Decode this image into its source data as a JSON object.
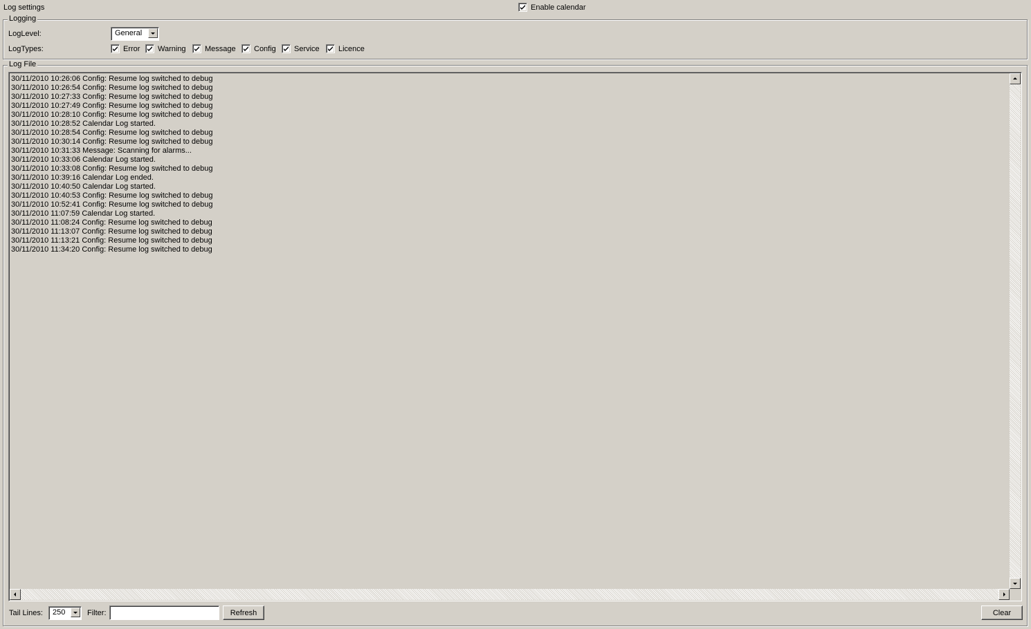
{
  "header": {
    "title": "Log settings",
    "enable_calendar": {
      "label": "Enable calendar",
      "checked": true
    }
  },
  "logging": {
    "legend": "Logging",
    "loglevel_label": "LogLevel:",
    "loglevel_value": "General",
    "logtypes_label": "LogTypes:",
    "logtypes": [
      {
        "label": "Error",
        "checked": true
      },
      {
        "label": "Warning",
        "checked": true
      },
      {
        "label": "Message",
        "checked": true
      },
      {
        "label": "Config",
        "checked": true
      },
      {
        "label": "Service",
        "checked": true
      },
      {
        "label": "Licence",
        "checked": true
      }
    ]
  },
  "logfile": {
    "legend": "Log File",
    "lines": [
      "30/11/2010 10:26:06 Config: Resume log switched to debug",
      "30/11/2010 10:26:54 Config: Resume log switched to debug",
      "30/11/2010 10:27:33 Config: Resume log switched to debug",
      "30/11/2010 10:27:49 Config: Resume log switched to debug",
      "30/11/2010 10:28:10 Config: Resume log switched to debug",
      "30/11/2010 10:28:52 Calendar Log started.",
      "30/11/2010 10:28:54 Config: Resume log switched to debug",
      "30/11/2010 10:30:14 Config: Resume log switched to debug",
      "30/11/2010 10:31:33 Message: Scanning for alarms...",
      "30/11/2010 10:33:06 Calendar Log started.",
      "30/11/2010 10:33:08 Config: Resume log switched to debug",
      "30/11/2010 10:39:16 Calendar Log ended.",
      "30/11/2010 10:40:50 Calendar Log started.",
      "30/11/2010 10:40:53 Config: Resume log switched to debug",
      "30/11/2010 10:52:41 Config: Resume log switched to debug",
      "30/11/2010 11:07:59 Calendar Log started.",
      "30/11/2010 11:08:24 Config: Resume log switched to debug",
      "30/11/2010 11:13:07 Config: Resume log switched to debug",
      "30/11/2010 11:13:21 Config: Resume log switched to debug",
      "30/11/2010 11:34:20 Config: Resume log switched to debug"
    ]
  },
  "footer": {
    "tail_lines_label": "Tail Lines:",
    "tail_lines_value": "250",
    "filter_label": "Filter:",
    "filter_value": "",
    "refresh_label": "Refresh",
    "clear_label": "Clear"
  }
}
